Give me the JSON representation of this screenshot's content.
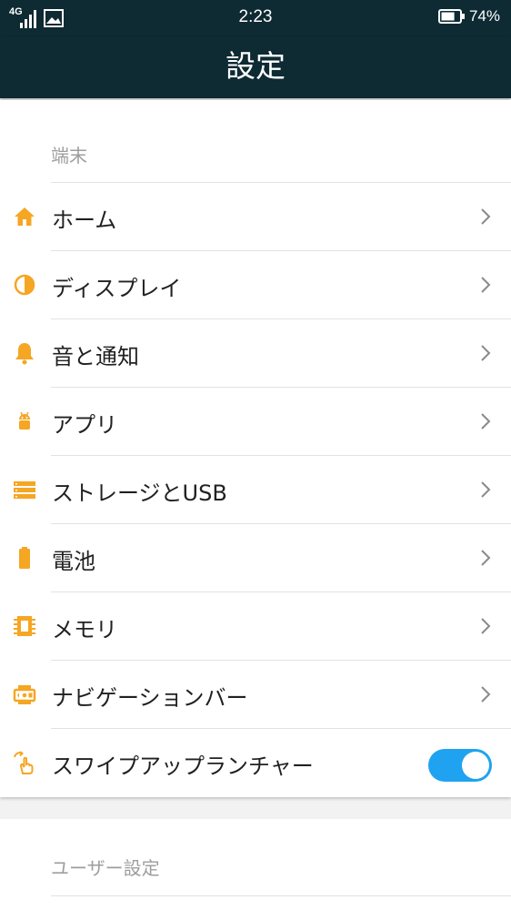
{
  "status_bar": {
    "network": "4G",
    "time": "2:23",
    "battery_percent": "74%",
    "battery_level": 0.74,
    "icons": [
      "signal-icon",
      "image-notification-icon",
      "battery-icon"
    ]
  },
  "app_bar": {
    "title": "設定"
  },
  "sections": {
    "device": {
      "header": "端末",
      "items": [
        {
          "label": "ホーム",
          "icon": "home-icon"
        },
        {
          "label": "ディスプレイ",
          "icon": "brightness-icon"
        },
        {
          "label": "音と通知",
          "icon": "bell-icon"
        },
        {
          "label": "アプリ",
          "icon": "android-icon"
        },
        {
          "label": "ストレージとUSB",
          "icon": "storage-icon"
        },
        {
          "label": "電池",
          "icon": "battery-icon"
        },
        {
          "label": "メモリ",
          "icon": "memory-chip-icon"
        },
        {
          "label": "ナビゲーションバー",
          "icon": "navigation-bar-icon"
        },
        {
          "label": "スワイプアップランチャー",
          "icon": "swipe-gesture-icon",
          "toggle_on": true
        }
      ]
    },
    "user": {
      "header": "ユーザー設定"
    }
  },
  "colors": {
    "bar_background": "#0e2a33",
    "accent_icon": "#f5a623",
    "toggle_on": "#1fa3f0",
    "text_primary": "#212121",
    "text_secondary": "#9e9e9e"
  }
}
